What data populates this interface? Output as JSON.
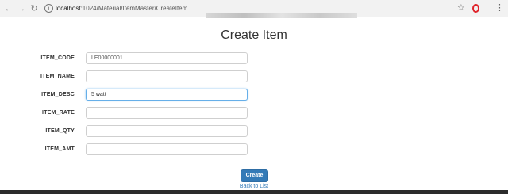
{
  "browser": {
    "url_scheme": "localhost",
    "url_rest": ":1024/Material/ItemMaster/CreateItem",
    "icons": [
      "back-icon",
      "forward-icon",
      "reload-icon",
      "info-icon",
      "star-icon",
      "opera-icon",
      "menu-icon"
    ]
  },
  "page": {
    "title": "Create Item"
  },
  "form": {
    "fields": [
      {
        "label": "ITEM_CODE",
        "value": "LE00000001"
      },
      {
        "label": "ITEM_NAME",
        "value": ""
      },
      {
        "label": "ITEM_DESC",
        "value": "5 watt"
      },
      {
        "label": "ITEM_RATE",
        "value": ""
      },
      {
        "label": "ITEM_QTY",
        "value": ""
      },
      {
        "label": "ITEM_AMT",
        "value": ""
      }
    ],
    "submit_label": "Create",
    "back_label": "Back to List"
  },
  "colors": {
    "primary": "#337ab7",
    "focus": "#66afe9"
  }
}
